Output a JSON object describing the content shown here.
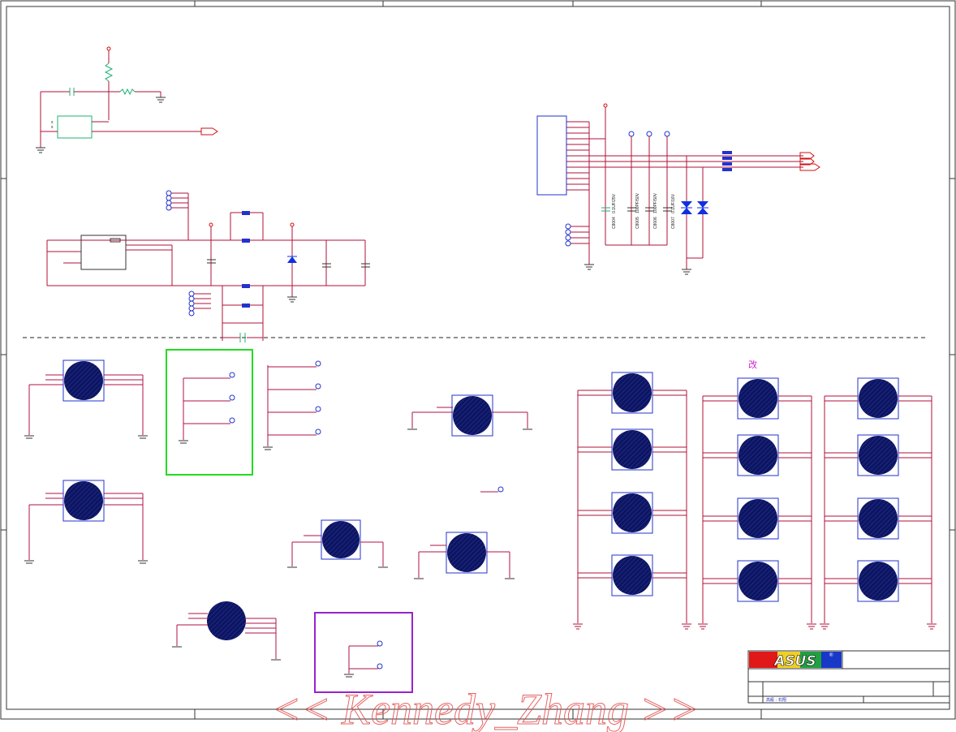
{
  "title_block": {
    "brand": "ASUS",
    "registered_mark": "®",
    "row_text": "高級 : 石翔"
  },
  "annotation_note": "改",
  "capacitors": [
    {
      "ref": "C8004",
      "value": "0.1UF/25V"
    },
    {
      "ref": "C8005",
      "value": "100PF/50V"
    },
    {
      "ref": "C8006",
      "value": "100PF/50V"
    },
    {
      "ref": "C8007",
      "value": "0.1UF/16V"
    }
  ],
  "watermark": "<< Kennedy_Zhang >>",
  "colors": {
    "wire": "#b0103a",
    "border": "#333333",
    "pad_fill": "#0d1561",
    "pad_outline": "#2233cc",
    "green_box": "#22dd22",
    "purple_box": "#9922cc",
    "diode": "#1030e0",
    "component_green": "#20b070",
    "note": "#d020d0",
    "watermark": "#e24a4a"
  }
}
